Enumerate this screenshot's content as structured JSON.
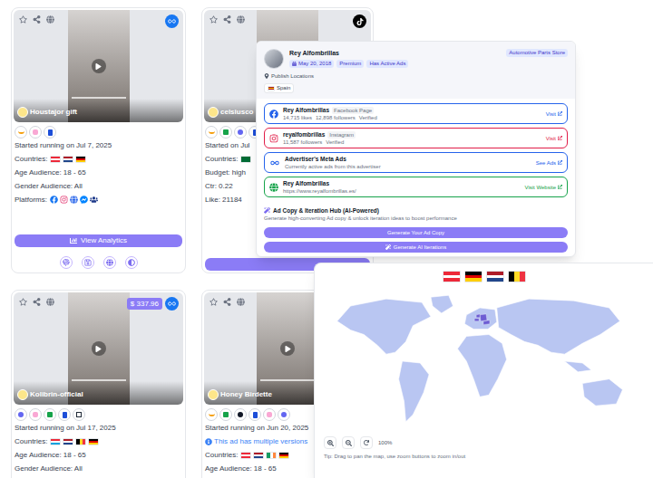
{
  "ad_cards": [
    {
      "name": "Houstajor gift",
      "network": "meta",
      "payments": [
        "amazon",
        "klarna",
        "paypal"
      ],
      "details": [
        {
          "kind": "text",
          "text": "Started running on Jul 7, 2025"
        },
        {
          "kind": "flags",
          "text": "Countries:",
          "flags": [
            "at",
            "nl",
            "de"
          ]
        },
        {
          "kind": "text",
          "text": "Age Audience: 18 - 65"
        },
        {
          "kind": "text",
          "text": "Gender Audience: All"
        },
        {
          "kind": "platforms",
          "text": "Platforms:",
          "platforms": [
            "facebook",
            "instagram",
            "globe",
            "messenger",
            "audience"
          ]
        }
      ],
      "button": {
        "label": "View Analytics"
      },
      "actions": [
        "fingerprint",
        "save",
        "globe",
        "adjust"
      ]
    },
    {
      "name": "celsiusco",
      "network": "tiktok",
      "payments": [
        "amazon",
        "shopify",
        "stripe",
        "paypal"
      ],
      "details": [
        {
          "kind": "text",
          "text": "Started on Jul"
        },
        {
          "kind": "flags",
          "text": "Countries:",
          "flags": [
            "sa"
          ]
        },
        {
          "kind": "text",
          "text": "Budget: high"
        },
        {
          "kind": "text",
          "text": "Ctr: 0.22"
        },
        {
          "kind": "text",
          "text": "Like: 21184"
        }
      ],
      "button": {},
      "actions": []
    },
    {
      "name": "Kolibrin-official",
      "network": "meta",
      "price": "$ 337.96",
      "payments": [
        "stripe",
        "klarna",
        "shopify",
        "paypal",
        "square"
      ],
      "details": [
        {
          "kind": "text",
          "text": "Started running on Jul 17, 2025"
        },
        {
          "kind": "flags",
          "text": "Countries:",
          "flags": [
            "lu",
            "nl",
            "be",
            "de"
          ]
        },
        {
          "kind": "text",
          "text": "Age Audience: 18 - 65"
        },
        {
          "kind": "text",
          "text": "Gender Audience: All"
        }
      ]
    },
    {
      "name": "Honey Birdette",
      "payments": [
        "amazon",
        "shopify",
        "applepay",
        "paypal",
        "klarna",
        "stripe"
      ],
      "details": [
        {
          "kind": "text",
          "text": "Started running on Jun 20, 2025"
        },
        {
          "kind": "notice",
          "text": "This ad has multiple versions"
        },
        {
          "kind": "flags",
          "text": "Countries:",
          "flags": [
            "at",
            "nl",
            "ie",
            "de"
          ]
        },
        {
          "kind": "text",
          "text": "Age Audience: 18 - 65"
        }
      ]
    }
  ],
  "advertiser_panel": {
    "name": "Rey Alfombrillas",
    "chips": [
      "May 20, 2018",
      "Premium",
      "Has Active Ads"
    ],
    "category": "Automotive Parts Store",
    "locations_label": "Publish Locations",
    "locations": [
      {
        "name": "Spain",
        "flag": "es"
      }
    ],
    "links": [
      {
        "kind": "facebook",
        "title": "Rey Alfombrillas",
        "tag": "Facebook Page",
        "meta": [
          "14,715 likes",
          "12,898 followers",
          "Verified"
        ],
        "action": "Visit",
        "color": "#2563eb"
      },
      {
        "kind": "instagram",
        "title": "reyalfombrillas",
        "tag": "Instagram",
        "meta": [
          "11,587 followers",
          "Verified"
        ],
        "action": "Visit",
        "color": "#e11d48"
      },
      {
        "kind": "meta",
        "title": "Advertiser's Meta Ads",
        "meta": [
          "Currently active ads from this advertiser"
        ],
        "action": "See Ads",
        "color": "#2563eb"
      },
      {
        "kind": "website",
        "title": "Rey Alfombrillas",
        "meta": [
          "https://www.reyalfombrillas.es/"
        ],
        "action": "Visit Website",
        "color": "#16a34a"
      }
    ],
    "hub": {
      "title": "Ad Copy & Iteration Hub (AI-Powered)",
      "subtitle": "Generate high-converting Ad copy & unlock iteration ideas to boost performance",
      "buttons": [
        "Generate Your Ad Copy",
        "Generate AI Iterations"
      ]
    }
  },
  "map_panel": {
    "flags": [
      "at",
      "de",
      "nl",
      "be"
    ],
    "highlighted": [
      "at",
      "de",
      "nl",
      "be"
    ],
    "zoom": "100%",
    "tip": "Tip: Drag to pan the map, use zoom buttons to zoom in/out"
  }
}
